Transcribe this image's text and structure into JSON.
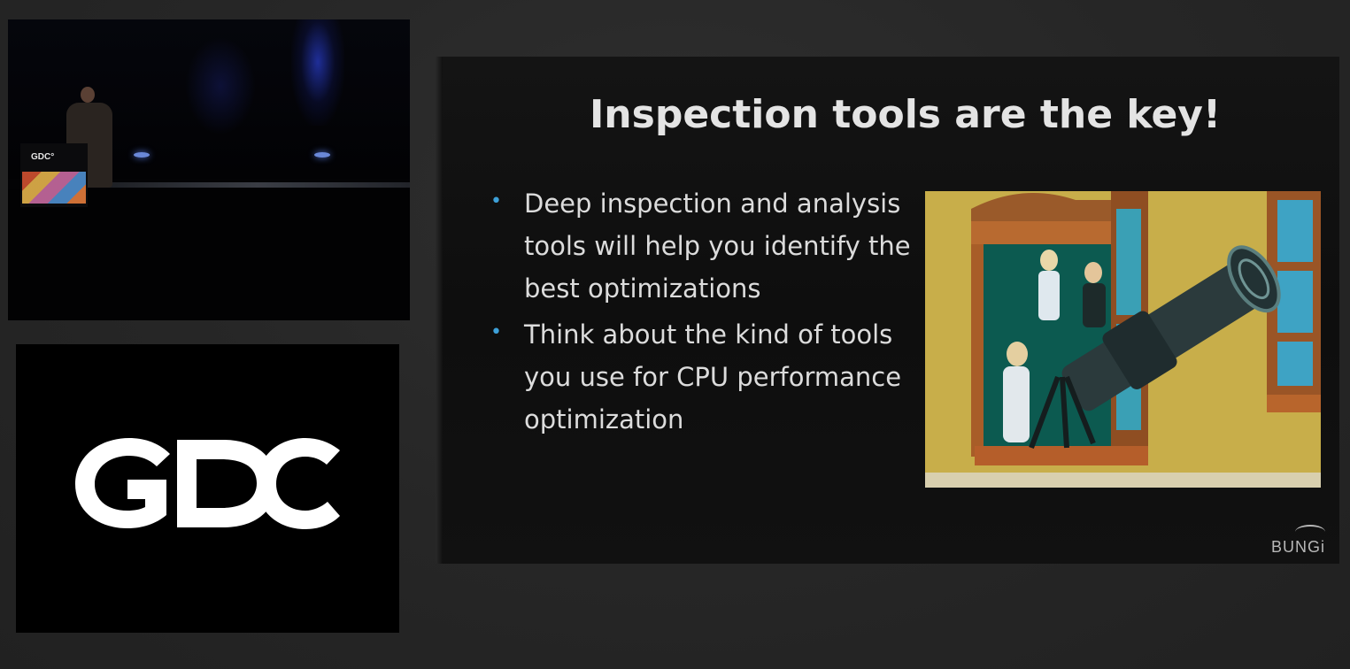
{
  "camera_feed": {
    "podium_sign": "GDC°"
  },
  "logo_panel": {
    "logo_name": "GDC logo"
  },
  "slide": {
    "title": "Inspection tools are the key!",
    "bullets": [
      {
        "text": "Deep inspection and analysis tools will help you identify the best optimizations"
      },
      {
        "text": "Think about the kind of tools you use for CPU performance optimization"
      }
    ],
    "footer_logo": "BUNGi"
  },
  "colors": {
    "page_background": "#272727",
    "slide_background": "#111111",
    "title_text": "#e4e4e4",
    "bullet_text": "#dcdcdc",
    "bullet_marker": "#3da0d8",
    "logo_panel_background": "#000000",
    "logo_fill": "#ffffff"
  }
}
